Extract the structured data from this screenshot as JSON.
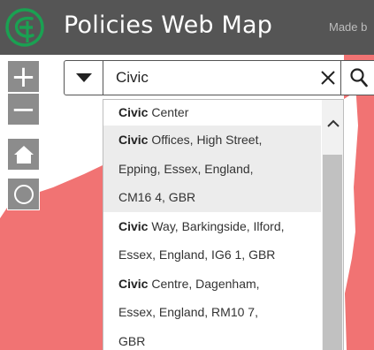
{
  "header": {
    "title": "Policies Web Map",
    "made_by": "Made b",
    "logo_icon": "circle-e-logo-icon"
  },
  "colors": {
    "header_bg": "#555555",
    "logo_green": "#1aa152",
    "map_feature": "#f17373",
    "control_bg": "#8c8c8c"
  },
  "map_controls": {
    "zoom_in": {
      "label": "+",
      "icon": "plus-icon"
    },
    "zoom_out": {
      "label": "−",
      "icon": "minus-icon"
    },
    "home": {
      "icon": "home-icon"
    },
    "locate": {
      "icon": "locate-icon"
    }
  },
  "search": {
    "value": "Civic",
    "toggle_icon": "caret-down-icon",
    "clear_icon": "close-icon",
    "search_icon": "search-icon"
  },
  "suggestions": [
    {
      "match": "Civic",
      "lines": [
        " Center"
      ],
      "highlight": false
    },
    {
      "match": "Civic",
      "lines": [
        " Offices, High Street,",
        "Epping, Essex, England,",
        "CM16 4, GBR"
      ],
      "highlight": true
    },
    {
      "match": "Civic",
      "lines": [
        " Way, Barkingside, Ilford,",
        "Essex, England, IG6 1, GBR"
      ],
      "highlight": false
    },
    {
      "match": "Civic",
      "lines": [
        " Centre, Dagenham,",
        "Essex, England, RM10 7,",
        "GBR"
      ],
      "highlight": false
    }
  ]
}
